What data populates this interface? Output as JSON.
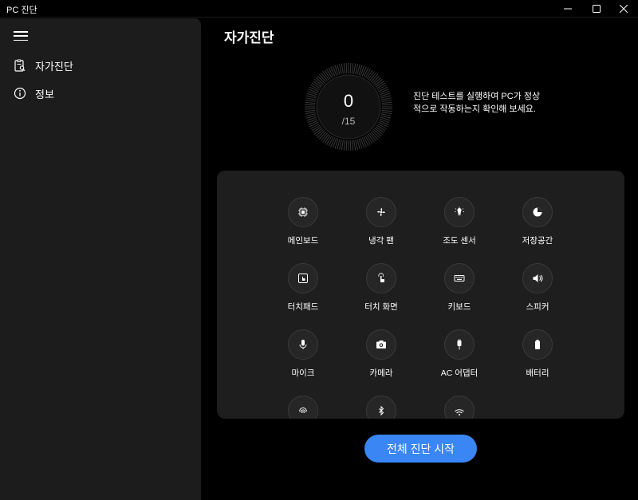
{
  "window": {
    "title": "PC 진단",
    "minimize_icon": "minimize-icon",
    "maximize_icon": "maximize-icon",
    "close_icon": "close-icon"
  },
  "sidebar": {
    "menu_icon": "hamburger-icon",
    "items": [
      {
        "label": "자가진단",
        "icon": "clipboard-search-icon"
      },
      {
        "label": "정보",
        "icon": "info-icon"
      }
    ]
  },
  "main": {
    "title": "자가진단",
    "score": {
      "value": "0",
      "total": "/15"
    },
    "description": "진단 테스트를 실행하여 PC가 정상적으로 작동하는지 확인해 보세요.",
    "tests": [
      {
        "label": "메인보드",
        "icon": "chip-icon"
      },
      {
        "label": "냉각 팬",
        "icon": "fan-icon"
      },
      {
        "label": "조도 센서",
        "icon": "light-sensor-icon"
      },
      {
        "label": "저장공간",
        "icon": "storage-pie-icon"
      },
      {
        "label": "터치패드",
        "icon": "touchpad-icon"
      },
      {
        "label": "터치 화면",
        "icon": "touch-screen-icon"
      },
      {
        "label": "키보드",
        "icon": "keyboard-icon"
      },
      {
        "label": "스피커",
        "icon": "speaker-icon"
      },
      {
        "label": "마이크",
        "icon": "microphone-icon"
      },
      {
        "label": "카메라",
        "icon": "camera-icon"
      },
      {
        "label": "AC 어댑터",
        "icon": "ac-adapter-icon"
      },
      {
        "label": "배터리",
        "icon": "battery-icon"
      },
      {
        "label": "",
        "icon": "fingerprint-icon"
      },
      {
        "label": "",
        "icon": "bluetooth-icon"
      },
      {
        "label": "",
        "icon": "wifi-icon"
      }
    ],
    "start_button": "전체 진단 시작"
  },
  "colors": {
    "accent": "#3a86f5",
    "sidebar_bg": "#1c1c1c",
    "panel_bg": "#1e1e1e"
  }
}
